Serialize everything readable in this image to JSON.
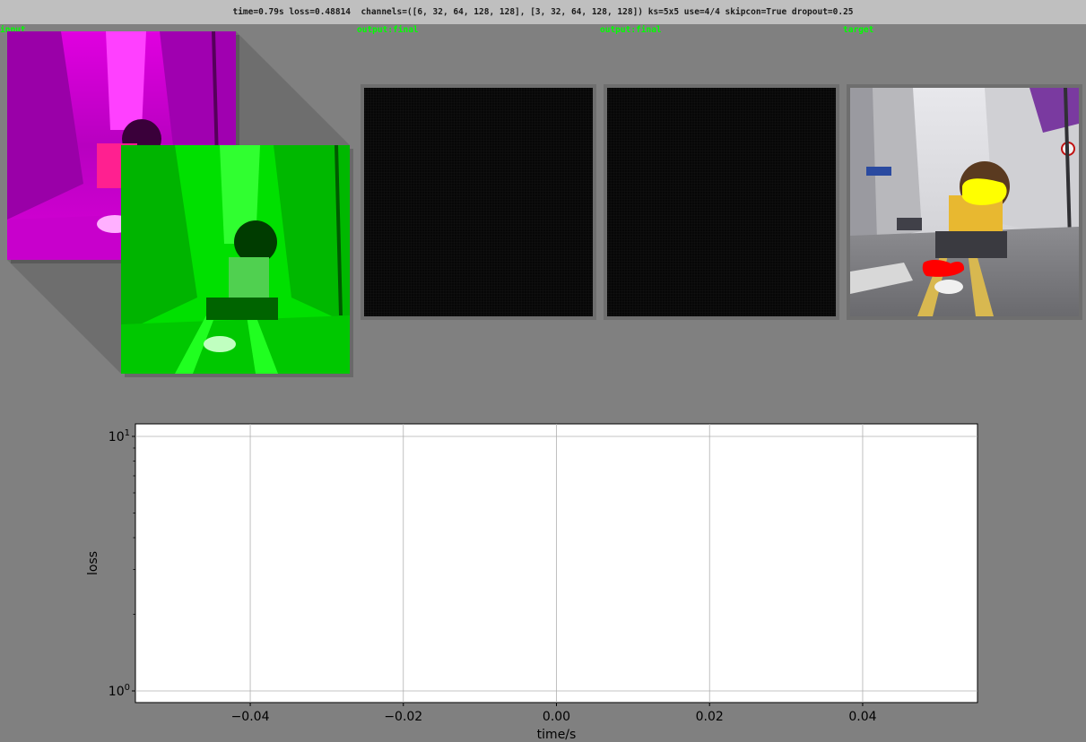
{
  "header": {
    "status": "time=0.79s loss=0.48814  channels=([6, 32, 64, 128, 128], [3, 32, 64, 128, 128]) ks=5x5 use=4/4 skipcon=True dropout=0.25"
  },
  "panels": {
    "input_label": "input",
    "output1_label": "output:final",
    "output2_label": "output:final",
    "target_label": "target"
  },
  "colors": {
    "background": "#808080",
    "label_color": "#00ff00",
    "input_magenta": "#ff00ff",
    "input_green": "#00ff00",
    "output_black": "#000000",
    "target_yellow": "#ffff00",
    "target_red": "#ff0000"
  },
  "chart_data": {
    "type": "line",
    "title": "",
    "xlabel": "time/s",
    "ylabel": "loss",
    "xlim": [
      -0.055,
      0.055
    ],
    "ylim": [
      0.9,
      11.2
    ],
    "yscale": "log",
    "grid": true,
    "xticks": [
      {
        "value": -0.04,
        "label": "−0.04"
      },
      {
        "value": -0.02,
        "label": "−0.02"
      },
      {
        "value": 0.0,
        "label": "0.00"
      },
      {
        "value": 0.02,
        "label": "0.02"
      },
      {
        "value": 0.04,
        "label": "0.04"
      }
    ],
    "yticks": [
      {
        "value": 10,
        "base": "10",
        "exp": "1"
      },
      {
        "value": 1,
        "base": "10",
        "exp": "0"
      }
    ],
    "series": []
  }
}
